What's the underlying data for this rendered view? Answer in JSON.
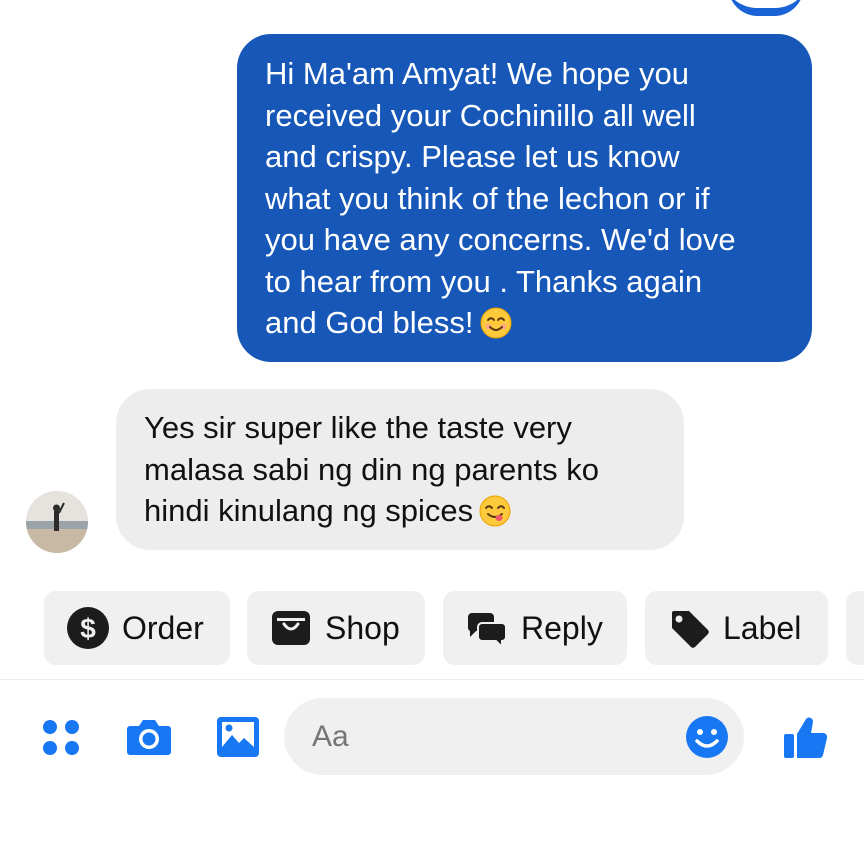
{
  "conversation": {
    "outgoing_message": "Hi Ma'am Amyat! We hope you\nreceived your Cochinillo all well\nand crispy. Please let us know\nwhat you think of the lechon or if\nyou have any concerns. We'd love\nto hear from you . Thanks again\nand God bless!",
    "outgoing_emoji": "smiling-face-with-smiling-eyes",
    "incoming_message": "Yes sir super like the taste very\nmalasa sabi ng din ng parents ko\nhindi kinulang ng spices",
    "incoming_emoji": "face-savoring-food"
  },
  "quick_actions": [
    {
      "label": "Order",
      "icon": "dollar-circle-icon"
    },
    {
      "label": "Shop",
      "icon": "shopping-bag-icon"
    },
    {
      "label": "Reply",
      "icon": "chat-bubbles-icon"
    },
    {
      "label": "Label",
      "icon": "tag-icon"
    }
  ],
  "composer": {
    "placeholder": "Aa",
    "icons": [
      "four-dots-menu-icon",
      "camera-icon",
      "gallery-icon",
      "smiley-icon",
      "thumbs-up-icon"
    ]
  },
  "colors": {
    "accent": "#1877f2",
    "outgoing_bubble": "#1657b8",
    "incoming_bubble": "#ededed",
    "chip_bg": "#f0f0f0"
  }
}
